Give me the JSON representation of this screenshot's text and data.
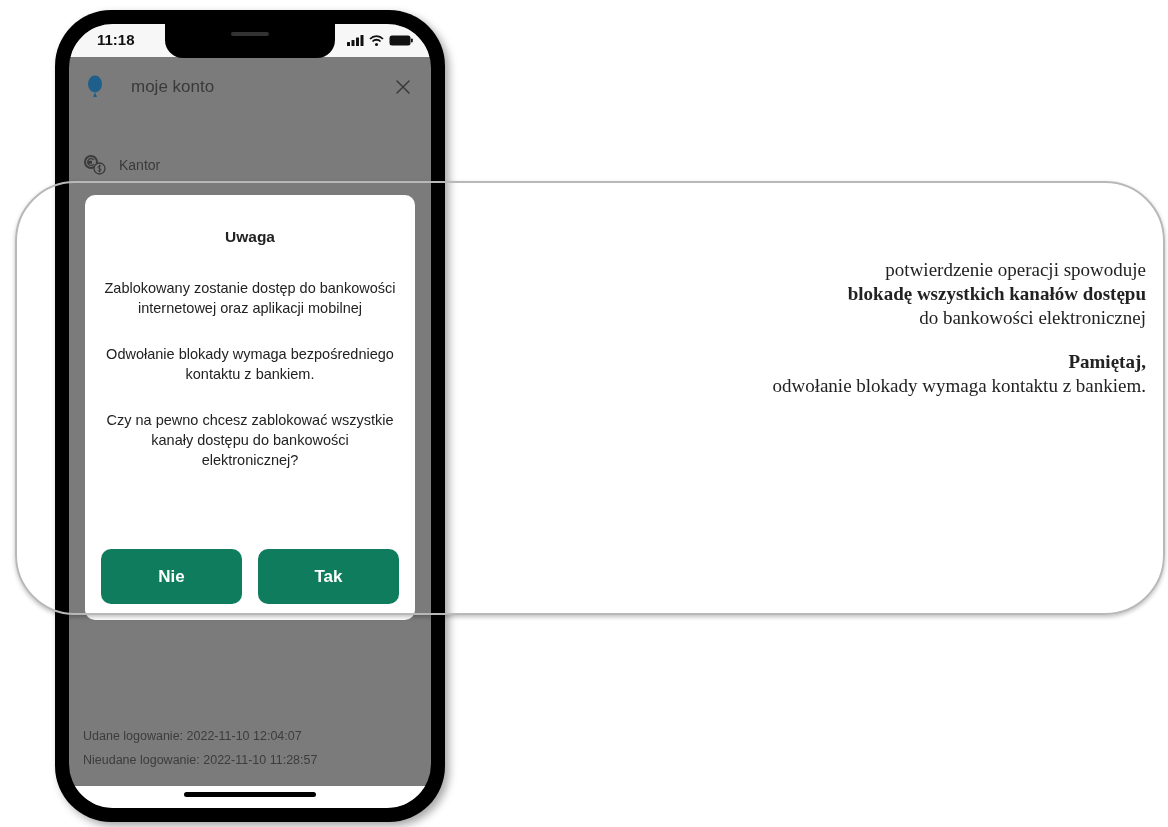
{
  "status_bar": {
    "time": "11:18"
  },
  "header": {
    "title": "moje konto"
  },
  "menu_items": [
    {
      "label": "Kantor"
    }
  ],
  "dialog": {
    "title": "Uwaga",
    "paragraphs": [
      "Zablokowany zostanie dostęp do bankowości internetowej oraz aplikacji mobilnej",
      "Odwołanie blokady wymaga bezpośredniego kontaktu z bankiem.",
      "Czy na pewno chcesz zablokować wszystkie kanały dostępu do bankowości elektronicznej?"
    ],
    "buttons": [
      {
        "label": "Nie"
      },
      {
        "label": "Tak"
      }
    ]
  },
  "login_info": [
    "Udane logowanie: 2022-11-10 12:04:07",
    "Nieudane logowanie: 2022-11-10 11:28:57"
  ],
  "callout": {
    "paragraphs": [
      "potwierdzenie operacji spowoduje\n**blokadę wszystkich kanałów dostępu**\ndo bankowości elektronicznej",
      "**Pamiętaj,**\nodwołanie blokady wymaga kontaktu z bankiem."
    ]
  }
}
